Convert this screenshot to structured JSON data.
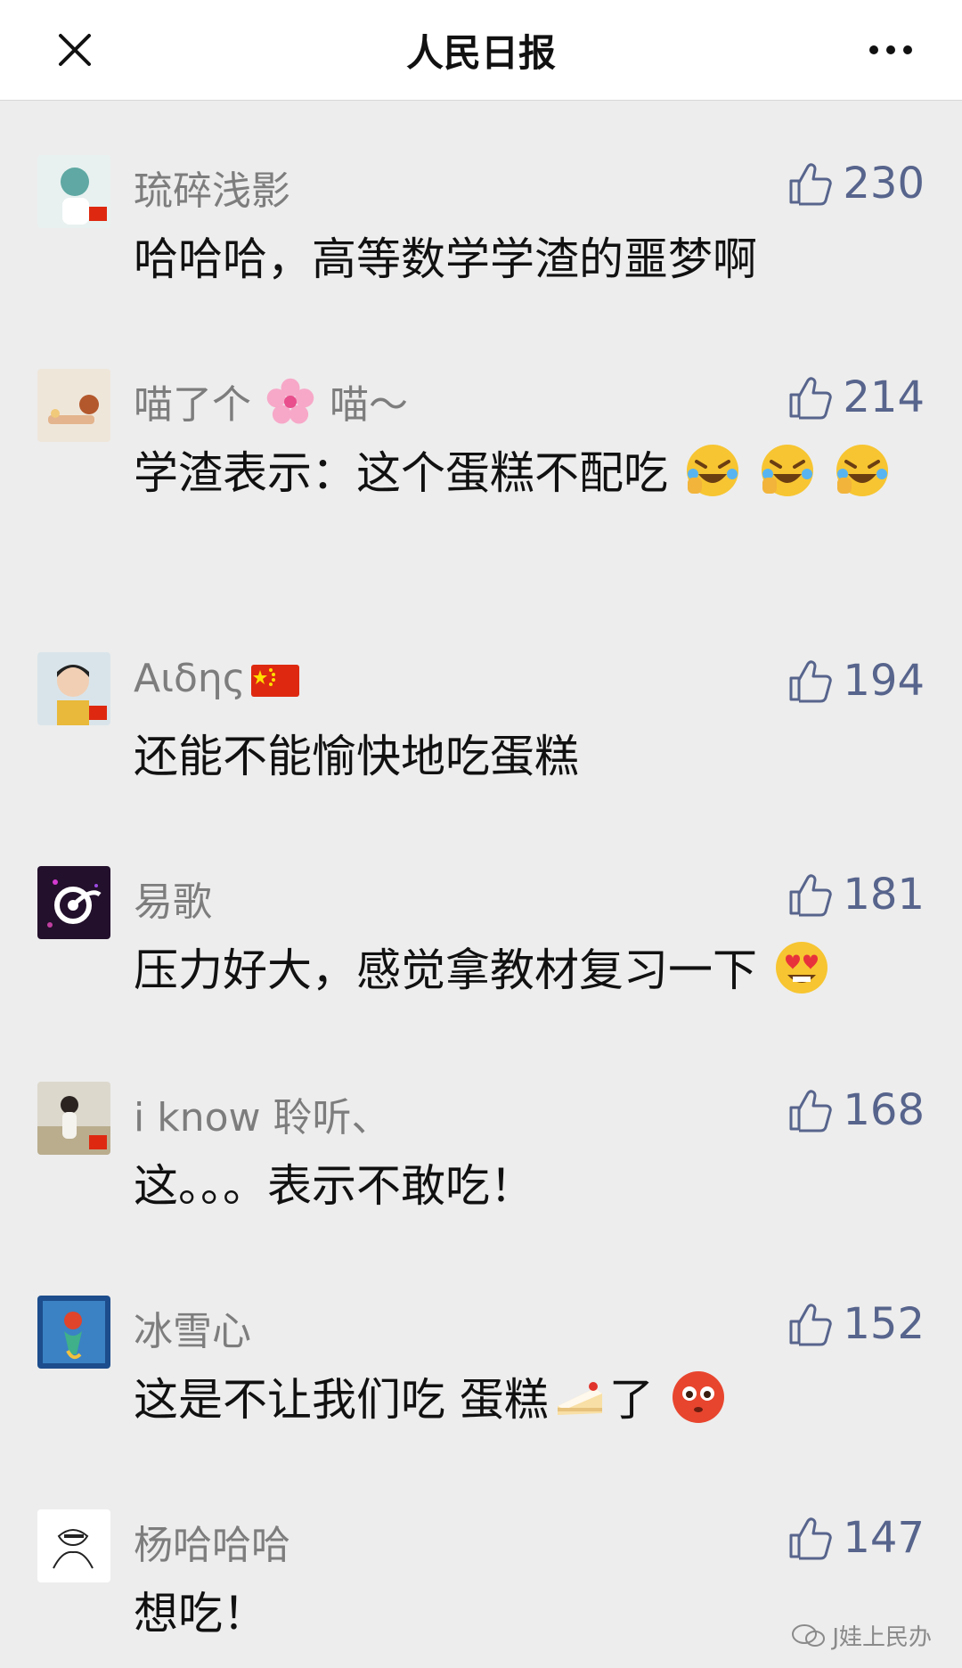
{
  "header": {
    "title": "人民日报"
  },
  "comments": [
    {
      "name": "琉碎浅影",
      "likes": "230",
      "text": "哈哈哈，高等数学学渣的噩梦啊"
    },
    {
      "name_before": "喵了个",
      "name_after": " 喵～",
      "likes": "214",
      "text": "学渣表示：这个蛋糕不配吃"
    },
    {
      "name": "Αιδης",
      "likes": "194",
      "text": "还能不能愉快地吃蛋糕"
    },
    {
      "name": "易歌",
      "likes": "181",
      "text": "压力好大，感觉拿教材复习一下"
    },
    {
      "name": "i know 聆听、",
      "likes": "168",
      "text": "这。。。表示不敢吃！"
    },
    {
      "name": "冰雪心",
      "likes": "152",
      "text_before": "这是不让我们吃 蛋糕",
      "text_after": "了"
    },
    {
      "name": "杨哈哈哈",
      "likes": "147",
      "text": "想吃！"
    }
  ],
  "watermark": {
    "text": "J娃上民办"
  },
  "colors": {
    "like": "#57648c",
    "name": "#7d7d7d",
    "background": "#ededed"
  }
}
